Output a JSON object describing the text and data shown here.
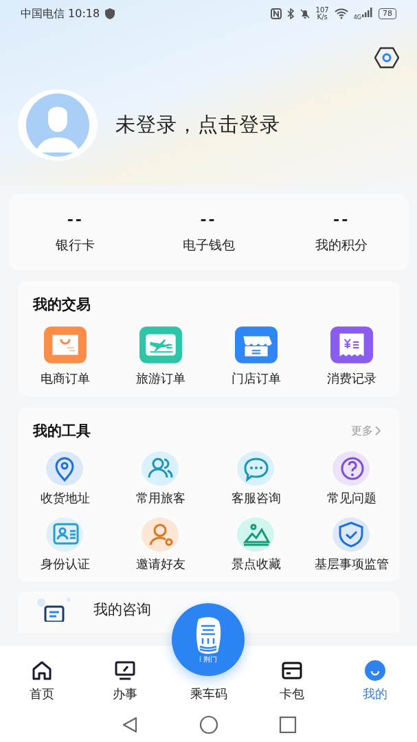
{
  "status_bar": {
    "carrier_time": "中国电信 10:18",
    "speed_value": "107",
    "speed_unit": "K/s",
    "network": "4G",
    "battery": "78"
  },
  "profile": {
    "login_prompt": "未登录，点击登录"
  },
  "stats": [
    {
      "value": "--",
      "label": "银行卡"
    },
    {
      "value": "--",
      "label": "电子钱包"
    },
    {
      "value": "--",
      "label": "我的积分"
    }
  ],
  "my_transactions": {
    "title": "我的交易",
    "items": [
      {
        "label": "电商订单"
      },
      {
        "label": "旅游订单"
      },
      {
        "label": "门店订单"
      },
      {
        "label": "消费记录"
      }
    ]
  },
  "my_tools": {
    "title": "我的工具",
    "more": "更多",
    "items": [
      {
        "label": "收货地址"
      },
      {
        "label": "常用旅客"
      },
      {
        "label": "客服咨询"
      },
      {
        "label": "常见问题"
      },
      {
        "label": "身份认证"
      },
      {
        "label": "邀请好友"
      },
      {
        "label": "景点收藏"
      },
      {
        "label": "基层事项监管"
      }
    ]
  },
  "consult": {
    "title": "我的咨询"
  },
  "tab_bar": {
    "center_logo_text": "i 荆门",
    "tabs": [
      {
        "label": "首页",
        "selected": false
      },
      {
        "label": "办事",
        "selected": false
      },
      {
        "label": "乘车码",
        "selected": false
      },
      {
        "label": "卡包",
        "selected": false
      },
      {
        "label": "我的",
        "selected": true
      }
    ]
  }
}
